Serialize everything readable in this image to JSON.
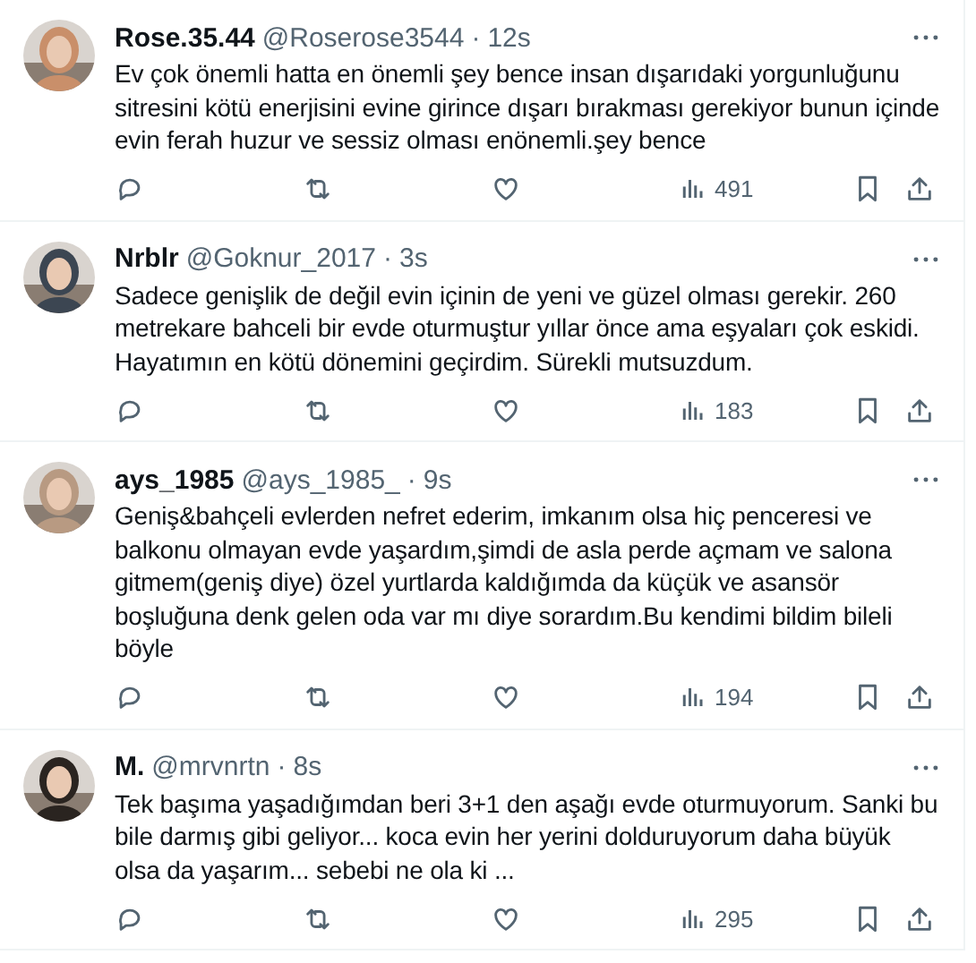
{
  "tweets": [
    {
      "name": "Rose.35.44",
      "handle": "@Roserose3544",
      "separator": "·",
      "time": "12s",
      "text": "Ev çok önemli hatta en önemli şey bence insan dışarıdaki yorgunluğunu sitresini kötü enerjisini evine girince dışarı bırakması gerekiyor bunun içinde evin ferah huzur ve sessiz olması enönemli.şey bence",
      "views": "491"
    },
    {
      "name": "Nrblr",
      "handle": "@Goknur_2017",
      "separator": "·",
      "time": "3s",
      "text": "Sadece genişlik de değil evin içinin de yeni ve güzel olması gerekir. 260 metrekare bahceli bir evde oturmuştur yıllar önce ama eşyaları çok eskidi. Hayatımın en kötü dönemini geçirdim. Sürekli mutsuzdum.",
      "views": "183"
    },
    {
      "name": "ays_1985",
      "handle": "@ays_1985_",
      "separator": "·",
      "time": "9s",
      "text": "Geniş&bahçeli evlerden nefret ederim, imkanım olsa hiç penceresi ve balkonu olmayan evde yaşardım,şimdi de asla perde açmam ve salona gitmem(geniş diye) özel yurtlarda kaldığımda da küçük ve asansör boşluğuna denk gelen oda var mı diye sorardım.Bu kendimi bildim bileli böyle",
      "views": "194"
    },
    {
      "name": "M.",
      "handle": "@mrvnrtn",
      "separator": "·",
      "time": "8s",
      "text": "Tek başıma yaşadığımdan beri 3+1 den aşağı evde oturmuyorum. Sanki bu bile darmış gibi geliyor... koca evin her yerini dolduruyorum daha büyük olsa da yaşarım... sebebi ne ola ki ...",
      "views": "295"
    }
  ]
}
